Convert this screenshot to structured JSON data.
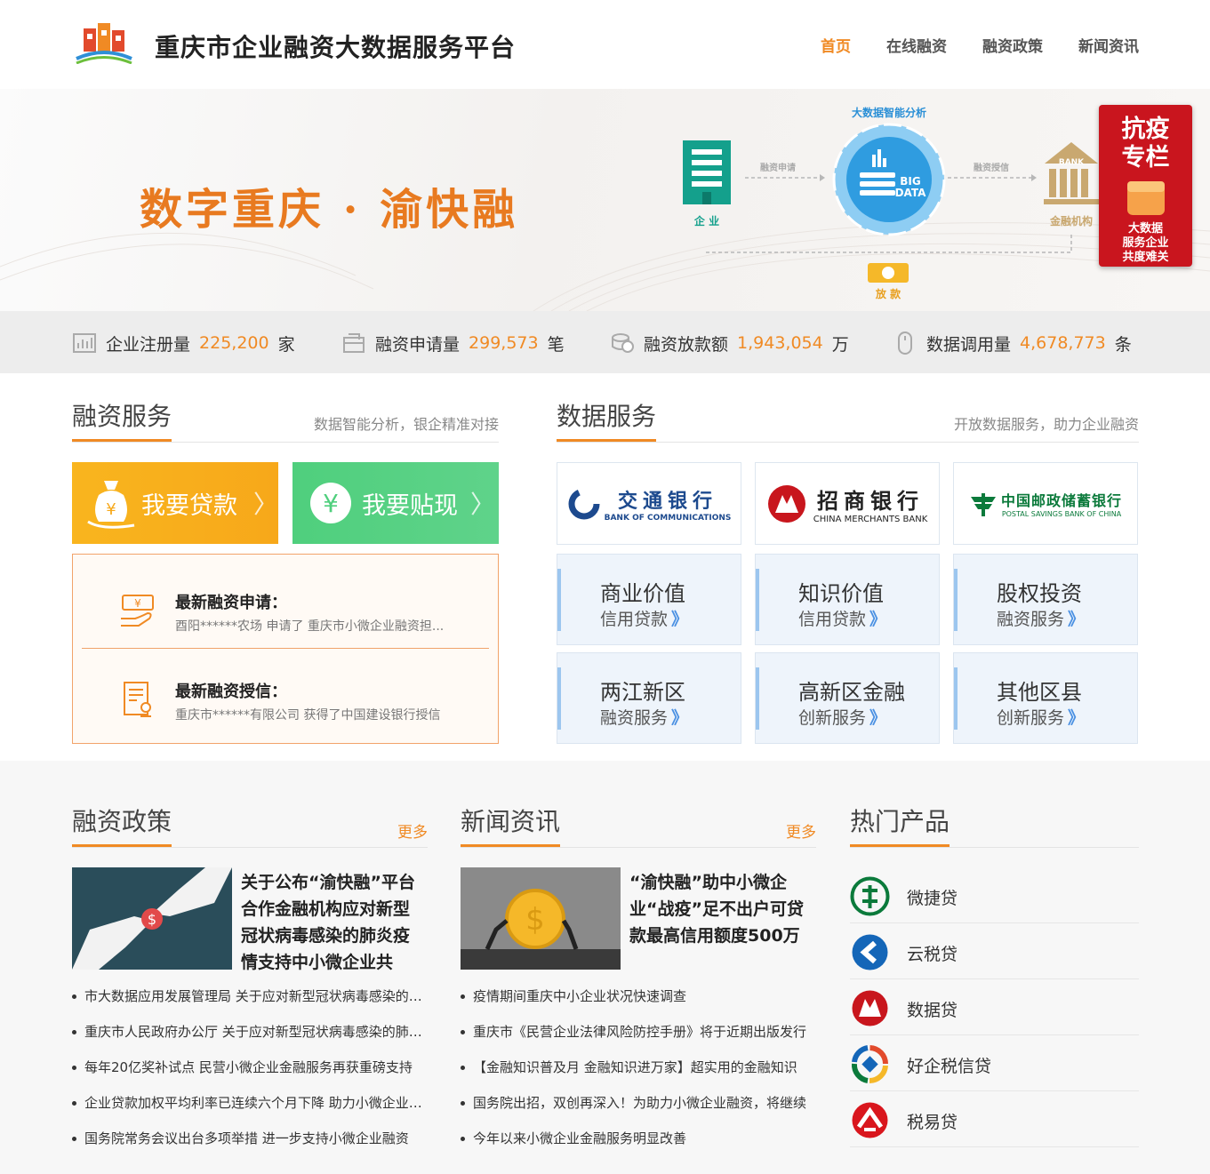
{
  "header": {
    "title": "重庆市企业融资大数据服务平台",
    "nav": [
      "首页",
      "在线融资",
      "融资政策",
      "新闻资讯"
    ],
    "active_index": 0
  },
  "banner": {
    "slogan": "数字重庆 · 渝快融",
    "flow": {
      "top_label": "大数据智能分析",
      "company_label": "企 业",
      "apply_label": "融资申请",
      "credit_label": "融资授信",
      "institution_label": "金融机构",
      "bank_sign": "BANK",
      "big_data": [
        "BIG",
        "DATA"
      ],
      "loan_label": "放 款"
    },
    "promo": {
      "title": [
        "抗疫",
        "专栏"
      ],
      "subtitle": [
        "大数据",
        "服务企业",
        "共度难关"
      ]
    }
  },
  "stats": [
    {
      "label": "企业注册量",
      "value": "225,200",
      "unit": "家"
    },
    {
      "label": "融资申请量",
      "value": "299,573",
      "unit": "笔"
    },
    {
      "label": "融资放款额",
      "value": "1,943,054",
      "unit": "万"
    },
    {
      "label": "数据调用量",
      "value": "4,678,773",
      "unit": "条"
    }
  ],
  "financing_service": {
    "title": "融资服务",
    "subtitle": "数据智能分析，银企精准对接",
    "loan_button": "我要贷款",
    "discount_button": "我要贴现",
    "latest": [
      {
        "heading": "最新融资申请：",
        "detail": "酉阳******农场 申请了 重庆市小微企业融资担..."
      },
      {
        "heading": "最新融资授信：",
        "detail": "重庆市******有限公司 获得了中国建设银行授信"
      }
    ]
  },
  "data_service": {
    "title": "数据服务",
    "subtitle": "开放数据服务，助力企业融资",
    "banks": [
      {
        "cn": "交通银行",
        "en": "BANK OF COMMUNICATIONS",
        "color": "#1d4a8e"
      },
      {
        "cn": "招商银行",
        "en": "CHINA MERCHANTS BANK",
        "color": "#c8161d"
      },
      {
        "cn": "中国邮政储蓄银行",
        "en": "POSTAL SAVINGS BANK OF CHINA",
        "color": "#0b7a3b"
      }
    ],
    "services": [
      {
        "a": "商业价值",
        "b": "信用贷款"
      },
      {
        "a": "知识价值",
        "b": "信用贷款"
      },
      {
        "a": "股权投资",
        "b": "融资服务"
      },
      {
        "a": "两江新区",
        "b": "融资服务"
      },
      {
        "a": "高新区金融",
        "b": "创新服务"
      },
      {
        "a": "其他区县",
        "b": "创新服务"
      }
    ],
    "arrow": "》"
  },
  "policy": {
    "title": "融资政策",
    "more": "更多",
    "featured": "关于公布“渝快融”平台合作金融机构应对新型冠状病毒感染的肺炎疫情支持中小微企业共",
    "items": [
      "市大数据应用发展管理局 关于应对新型冠状病毒感染的肺炎疫情支持中小微企业",
      "重庆市人民政府办公厅 关于应对新型冠状病毒感染的肺炎疫情支持中小企业",
      "每年20亿奖补试点 民营小微企业金融服务再获重磅支持",
      "企业贷款加权平均利率已连续六个月下降 助力小微企业发展",
      "国务院常务会议出台多项举措 进一步支持小微企业融资"
    ]
  },
  "news": {
    "title": "新闻资讯",
    "more": "更多",
    "featured": "“渝快融”助中小微企业“战疫”足不出户可贷款最高信用额度500万",
    "items": [
      "疫情期间重庆中小企业状况快速调查",
      "重庆市《民营企业法律风险防控手册》将于近期出版发行",
      "【金融知识普及月 金融知识进万家】超实用的金融知识",
      "国务院出招，双创再深入！为助力小微企业融资，将继续",
      "今年以来小微企业金融服务明显改善"
    ]
  },
  "hot": {
    "title": "热门产品",
    "items": [
      {
        "name": "微捷贷",
        "color": "#0b7a3b"
      },
      {
        "name": "云税贷",
        "color": "#1466b8"
      },
      {
        "name": "数据贷",
        "color": "#c8161d"
      },
      {
        "name": "好企税信贷",
        "color": "#e8a020"
      },
      {
        "name": "税易贷",
        "color": "#d9161d"
      }
    ]
  }
}
